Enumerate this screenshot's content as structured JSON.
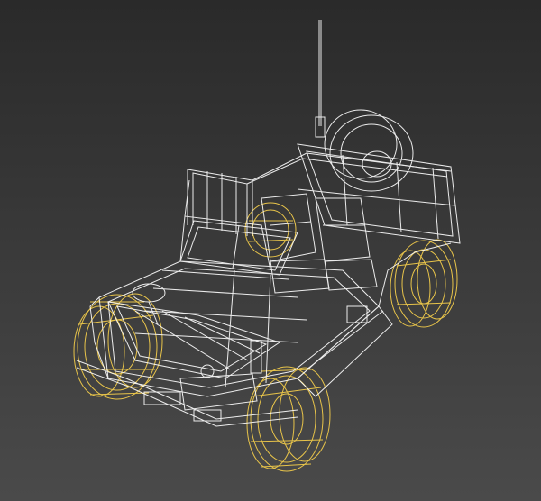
{
  "viewport": {
    "background_top": "#2a2a2a",
    "background_bottom": "#4a4a4a"
  },
  "wireframe": {
    "body_color": "#ffffff",
    "wheel_color": "#e8c44a",
    "body_opacity": 0.9
  }
}
